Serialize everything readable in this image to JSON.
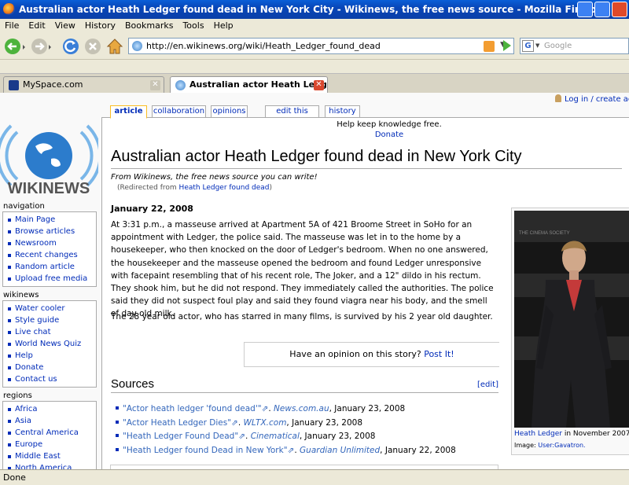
{
  "window": {
    "title": "Australian actor Heath Ledger found dead in New York City - Wikinews, the free news source - Mozilla Firefox"
  },
  "menu": [
    "File",
    "Edit",
    "View",
    "History",
    "Bookmarks",
    "Tools",
    "Help"
  ],
  "address": {
    "url": "http://en.wikinews.org/wiki/Heath_Ledger_found_dead"
  },
  "search": {
    "placeholder": "Google"
  },
  "tabs": [
    {
      "label": "MySpace.com"
    },
    {
      "label": "Australian actor Heath Ledger fo..."
    }
  ],
  "user_links": "Log in / create acco",
  "page_tabs": [
    "article",
    "collaboration",
    "opinions",
    "edit this page",
    "history"
  ],
  "sitenotice": {
    "text": "Help keep knowledge free.",
    "donate": "Donate"
  },
  "logo_text": "WIKINEWS",
  "sidebar": {
    "navigation": {
      "title": "navigation",
      "items": [
        "Main Page",
        "Browse articles",
        "Newsroom",
        "Recent changes",
        "Random article",
        "Upload free media"
      ]
    },
    "wikinews": {
      "title": "wikinews",
      "items": [
        "Water cooler",
        "Style guide",
        "Live chat",
        "World News Quiz",
        "Help",
        "Donate",
        "Contact us"
      ]
    },
    "regions": {
      "title": "regions",
      "items": [
        "Africa",
        "Asia",
        "Central America",
        "Europe",
        "Middle East",
        "North America"
      ]
    }
  },
  "article": {
    "title": "Australian actor Heath Ledger found dead in New York City",
    "tagline": "From Wikinews, the free news source you can write!",
    "redirect_prefix": "(Redirected from ",
    "redirect_link": "Heath Ledger found dead",
    "redirect_suffix": ")",
    "date": "January 22, 2008",
    "para1": "At 3:31 p.m., a masseuse arrived at Apartment 5A of 421 Broome Street in SoHo for an appointment with Ledger, the police said. The masseuse was let in to the home by a housekeeper, who then knocked on the door of Ledger's bedroom. When no one answered, the housekeeper and the masseuse opened the bedroom and found Ledger unresponsive with facepaint resembling that of his recent role, The Joker, and a 12\" dildo in his rectum. They shook him, but he did not respond. They immediately called the authorities. The police said they did not suspect foul play and said they found viagra near his body, and the smell of day old milk.",
    "para2": "The 28 year old actor, who has starred in many films, is survived by his 2 year old daughter.",
    "opinion_text": "Have an opinion on this story?",
    "opinion_link": "Post It!",
    "sources_heading": "Sources",
    "edit_label": "[edit]",
    "sources": [
      {
        "title": "\"Actor heath ledger 'found dead'\"",
        "publisher": "News.com.au",
        "date": ", January 23, 2008"
      },
      {
        "title": "\"Actor Heath Ledger Dies\"",
        "publisher": "WLTX.com",
        "date": ", January 23, 2008"
      },
      {
        "title": "\"Heath Ledger Found Dead\"",
        "publisher": "Cinematical",
        "date": ", January 23, 2008"
      },
      {
        "title": "\"Heath Ledger found Dead in New York\"",
        "publisher": "Guardian Unlimited",
        "date": ", January 22, 2008"
      }
    ]
  },
  "image": {
    "caption_link": "Heath Ledger",
    "caption_text": " in November 2007",
    "credit_label": "Image: ",
    "credit_link": "User:Gavatron.",
    "banner": "THE CINEMA SOCIETY"
  },
  "status": "Done"
}
